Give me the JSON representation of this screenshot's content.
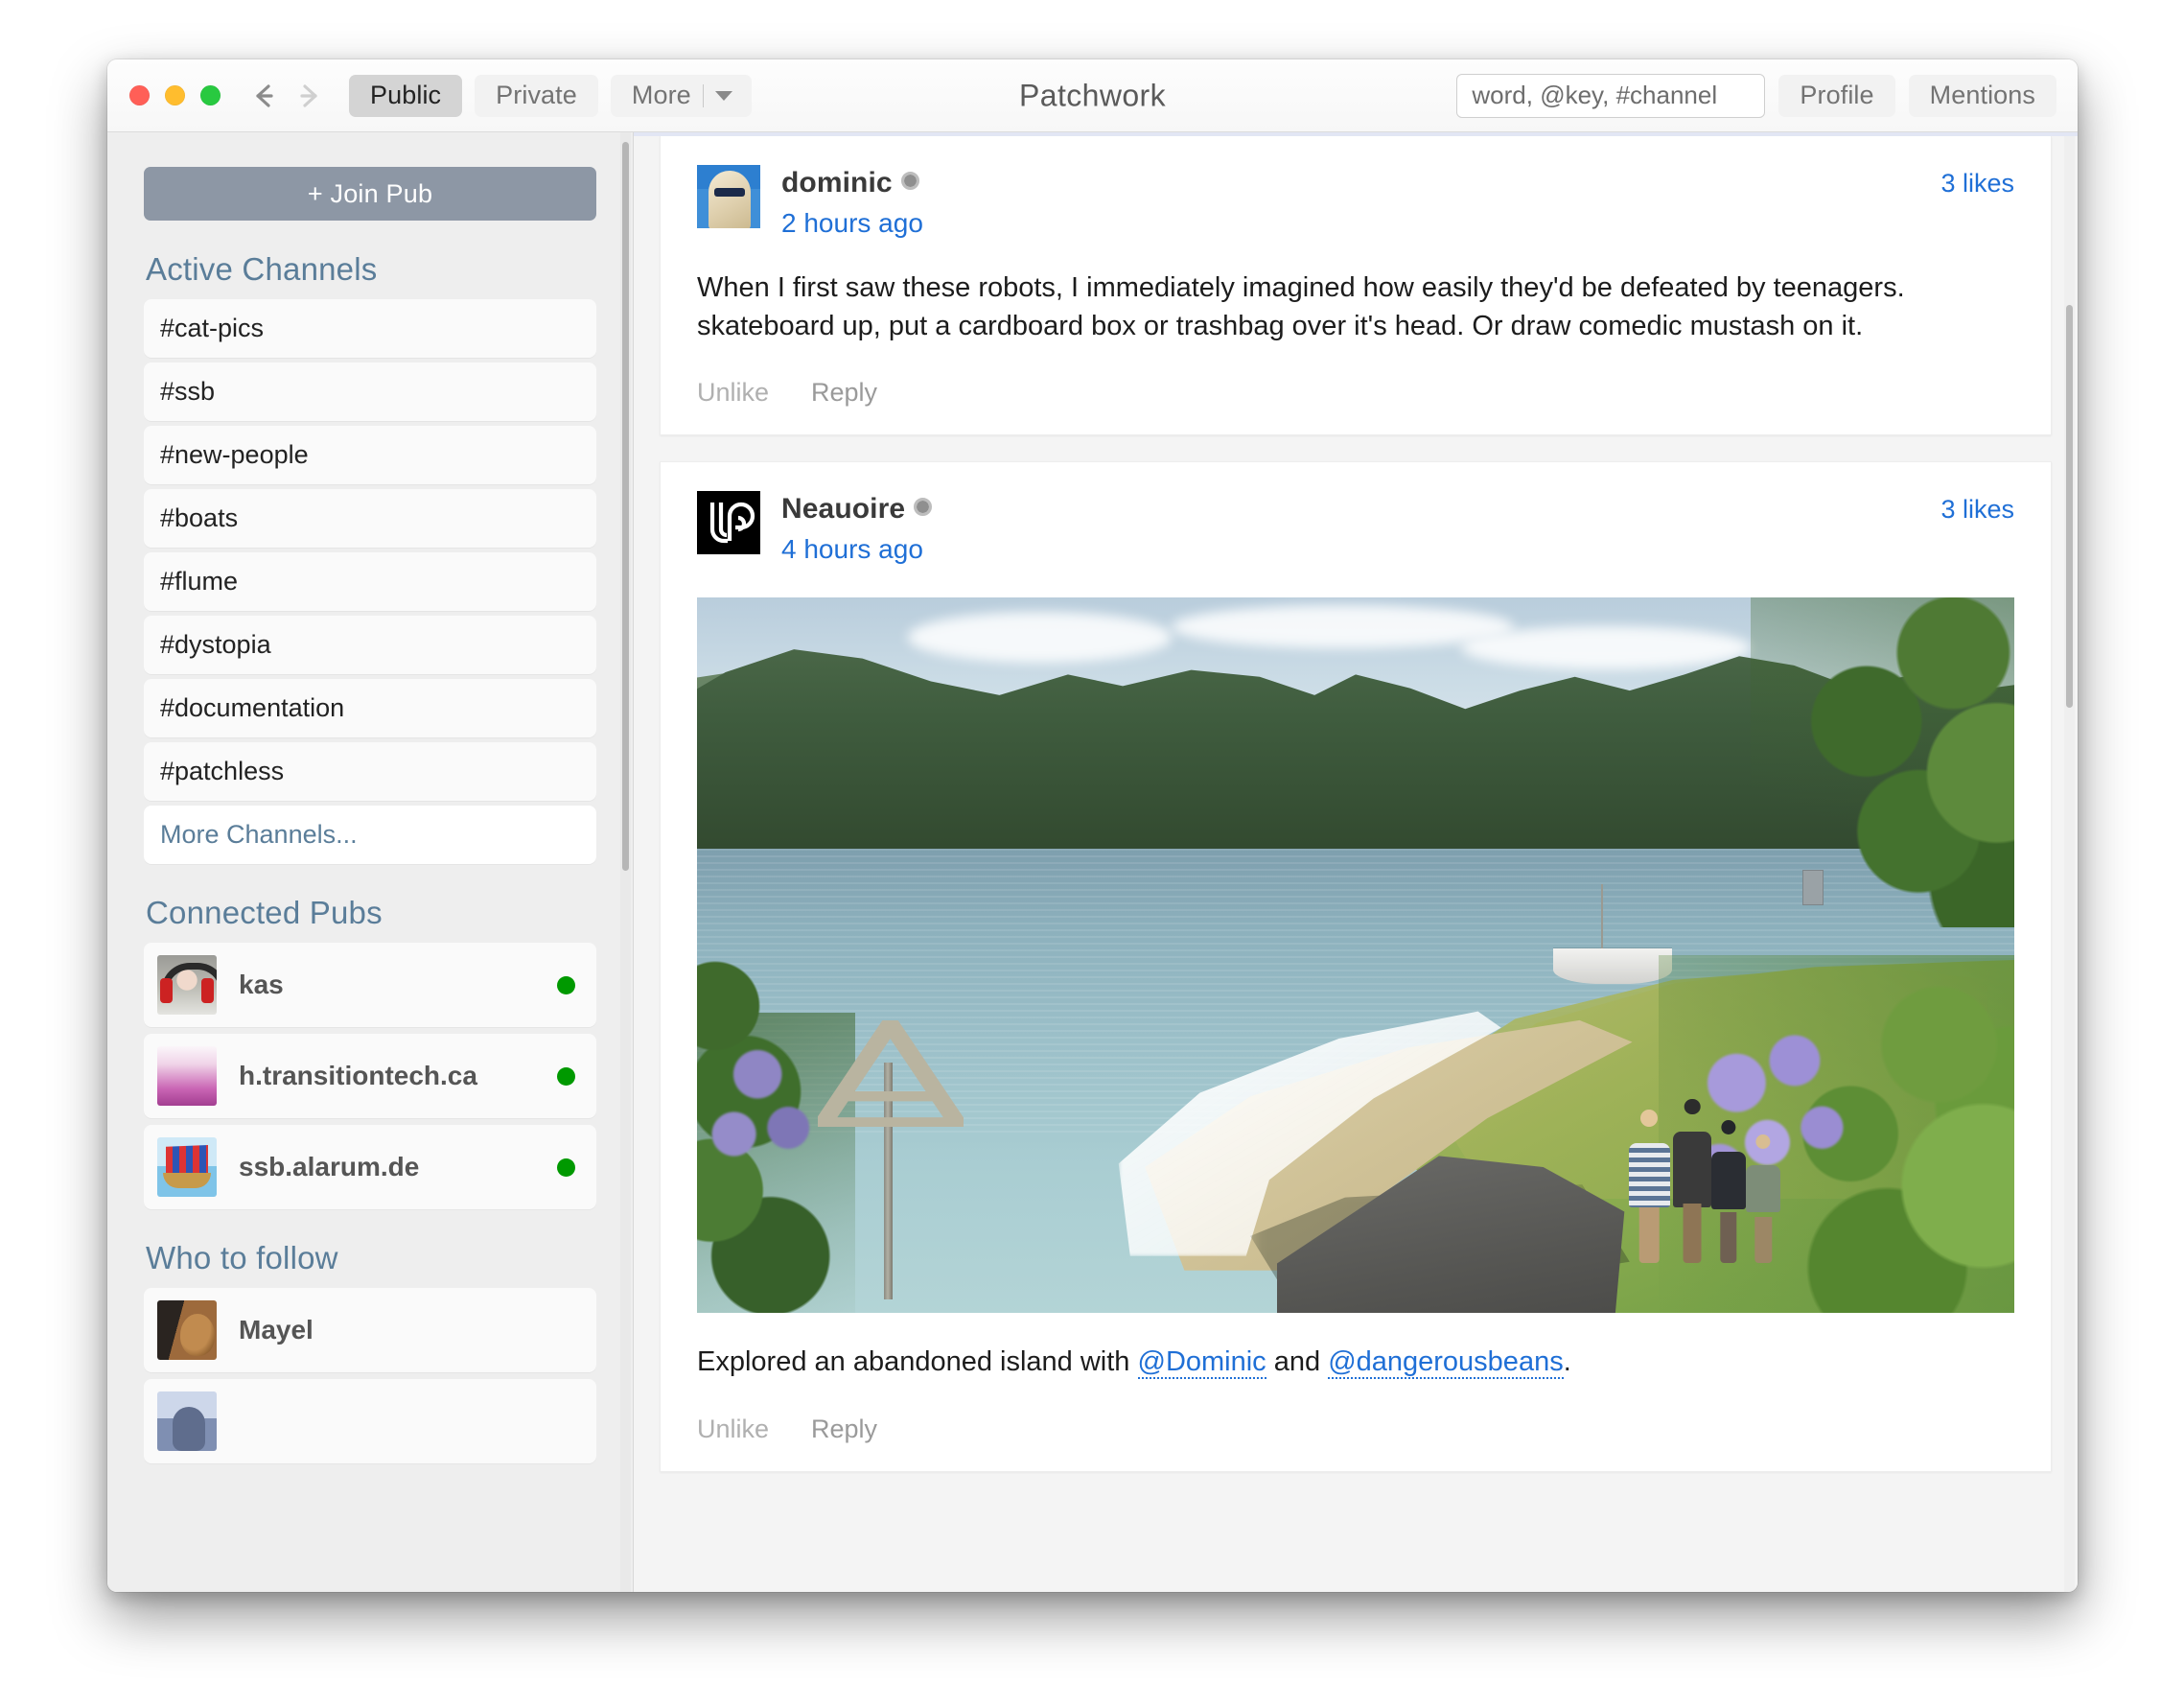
{
  "window": {
    "app_title": "Patchwork",
    "traffic_lights": [
      "close",
      "minimize",
      "zoom"
    ]
  },
  "toolbar": {
    "back_icon": "back-arrow-icon",
    "forward_icon": "forward-arrow-icon",
    "tabs": [
      {
        "label": "Public",
        "active": true
      },
      {
        "label": "Private",
        "active": false
      },
      {
        "label": "More",
        "active": false,
        "has_caret": true
      }
    ],
    "search_placeholder": "word, @key, #channel",
    "search_value": "",
    "profile_label": "Profile",
    "mentions_label": "Mentions"
  },
  "sidebar": {
    "join_pub_label": "+ Join Pub",
    "active_channels_title": "Active Channels",
    "channels": [
      "#cat-pics",
      "#ssb",
      "#new-people",
      "#boats",
      "#flume",
      "#dystopia",
      "#documentation",
      "#patchless"
    ],
    "more_channels_label": "More Channels...",
    "connected_pubs_title": "Connected Pubs",
    "pubs": [
      {
        "name": "kas",
        "status": "online",
        "avatar": "kas-photo-avatar"
      },
      {
        "name": "h.transitiontech.ca",
        "status": "online",
        "avatar": "pink-gradient-avatar"
      },
      {
        "name": "ssb.alarum.de",
        "status": "online",
        "avatar": "viking-ship-avatar"
      }
    ],
    "who_to_follow_title": "Who to follow",
    "follow_suggestions": [
      {
        "name": "Mayel",
        "avatar": "mayel-dog-photo-avatar"
      },
      {
        "name": "",
        "avatar": "partial-avatar"
      }
    ],
    "status_color": "#009900"
  },
  "feed": {
    "posts": [
      {
        "author": "dominic",
        "verified": true,
        "timestamp": "2 hours ago",
        "likes": "3 likes",
        "text": "When I first saw these robots, I immediately imagined how easily they'd be defeated by teenagers. skateboard up, put a cardboard box or trashbag over it's head. Or draw comedic mustash on it.",
        "avatar": "dominic-desert-photo-avatar",
        "actions": {
          "like": "Unlike",
          "reply": "Reply"
        },
        "has_photo": false
      },
      {
        "author": "Neauoire",
        "verified": true,
        "timestamp": "4 hours ago",
        "likes": "3 likes",
        "avatar": "neauoire-logo-avatar",
        "has_photo": true,
        "photo_alt": "coastal-landscape-photo",
        "caption_prefix": "Explored an abandoned island with ",
        "mention_1": "@Dominic",
        "caption_middle": " and ",
        "mention_2": "@dangerousbeans",
        "caption_suffix": "."
      }
    ]
  },
  "colors": {
    "accent_link": "#1f6fd6",
    "sidebar_heading": "#5a7d99",
    "join_pub_bg": "#8d97a5",
    "online_green": "#009900"
  }
}
